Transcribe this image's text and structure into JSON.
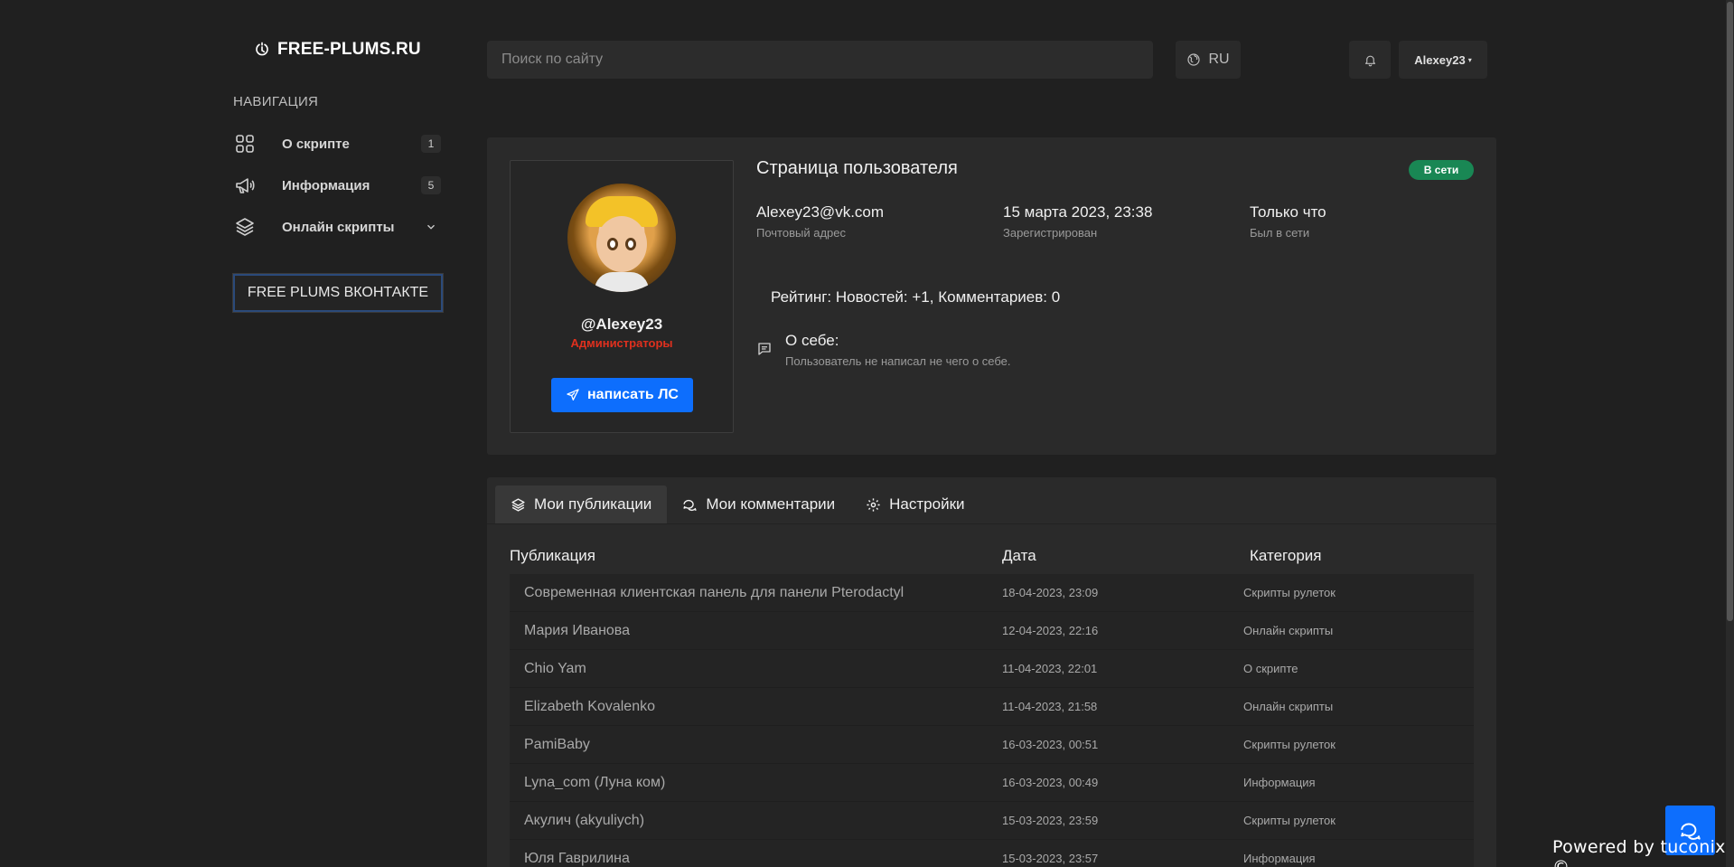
{
  "brand": {
    "name": "FREE-PLUMS.RU"
  },
  "sidebar": {
    "title": "НАВИГАЦИЯ",
    "items": [
      {
        "label": "О скрипте",
        "count": "1",
        "icon": "grid-icon"
      },
      {
        "label": "Информация",
        "count": "5",
        "icon": "megaphone-icon"
      },
      {
        "label": "Онлайн скрипты",
        "icon": "layers-icon"
      }
    ],
    "vk_button": "FREE PLUMS ВКОНТАКТЕ"
  },
  "header": {
    "search_placeholder": "Поиск по сайту",
    "lang": "RU",
    "user": "Alexey23"
  },
  "profile": {
    "page_title": "Страница пользователя",
    "status_badge": "В сети",
    "username": "@Alexey23",
    "role": "Администраторы",
    "message_button": "написать ЛС",
    "email": {
      "value": "Alexey23@vk.com",
      "label": "Почтовый адрес"
    },
    "registered": {
      "value": "15 марта 2023, 23:38",
      "label": "Зарегистрирован"
    },
    "last_seen": {
      "value": "Только что",
      "label": "Был в сети"
    },
    "rating": "Рейтинг: Новостей: +1, Комментариев: 0",
    "about_title": "О себе:",
    "about_text": "Пользователь не написал не чего о себе."
  },
  "tabs": [
    {
      "label": "Мои публикации",
      "icon": "layers-icon",
      "active": true
    },
    {
      "label": "Мои комментарии",
      "icon": "chat-icon",
      "active": false
    },
    {
      "label": "Настройки",
      "icon": "gear-icon",
      "active": false
    }
  ],
  "table": {
    "headers": {
      "publication": "Публикация",
      "date": "Дата",
      "category": "Категория"
    },
    "rows": [
      {
        "title": "Современная клиентская панель для панели Pterodactyl",
        "date": "18-04-2023, 23:09",
        "category": "Скрипты рулеток"
      },
      {
        "title": "Мария Иванова",
        "date": "12-04-2023, 22:16",
        "category": "Онлайн скрипты"
      },
      {
        "title": "Chio Yam",
        "date": "11-04-2023, 22:01",
        "category": "О скрипте"
      },
      {
        "title": "Elizabeth Kovalenko",
        "date": "11-04-2023, 21:58",
        "category": "Онлайн скрипты"
      },
      {
        "title": "PamiBaby",
        "date": "16-03-2023, 00:51",
        "category": "Скрипты рулеток"
      },
      {
        "title": "Lyna_com (Луна ком)",
        "date": "16-03-2023, 00:49",
        "category": "Информация"
      },
      {
        "title": "Акулич (akyuliych)",
        "date": "15-03-2023, 23:59",
        "category": "Скрипты рулеток"
      },
      {
        "title": "Юля Гаврилина",
        "date": "15-03-2023, 23:57",
        "category": "Информация"
      }
    ]
  },
  "footer": {
    "powered": "Powered by tuconix ©"
  },
  "colors": {
    "accent": "#0d6efd",
    "online": "#198754",
    "role": "#e0301e",
    "background": "#202020",
    "card": "#2a2a2a"
  }
}
